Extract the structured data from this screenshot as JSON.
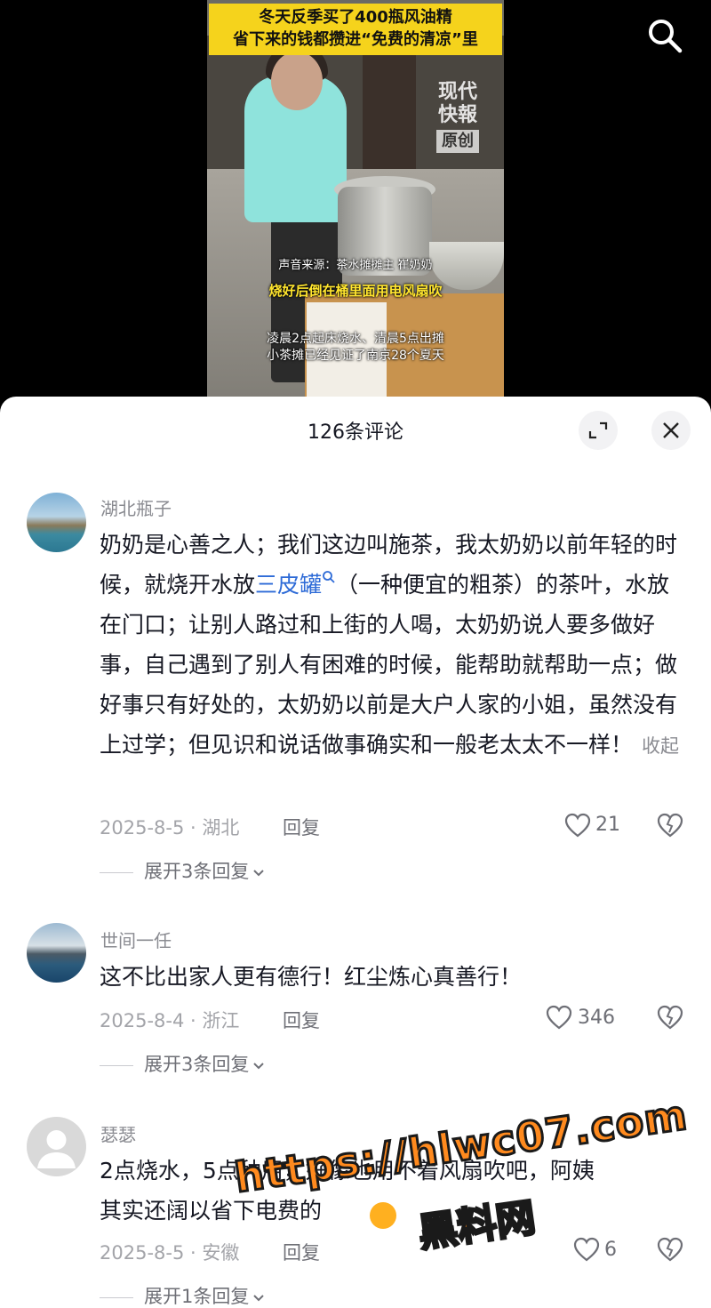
{
  "video": {
    "banner_line1": "冬天反季买了400瓶风油精",
    "banner_line2": "省下来的钱都攒进“免费的清凉”里",
    "logo_text_1": "现代",
    "logo_text_2": "快報",
    "logo_tag": "原创",
    "subtitle_source": "声音来源：茶水摊摊主 崔奶奶",
    "subtitle_main": "烧好后倒在桶里面用电风扇吹",
    "subtitle_line1": "凌晨2点起床烧水、清晨5点出摊",
    "subtitle_line2": "小茶摊已经见证了南京28个夏天",
    "search_icon": "search-icon"
  },
  "sheet": {
    "title": "126条评论",
    "expand_icon": "fullscreen-icon",
    "close_icon": "close-icon"
  },
  "comments": [
    {
      "author": "湖北瓶子",
      "text_before_link": "奶奶是心善之人；我们这边叫施茶，我太奶奶以前年轻的时候，就烧开水放",
      "link": "三皮罐",
      "text_after_link": "（一种便宜的粗茶）的茶叶，水放在门口；让别人路过和上街的人喝，太奶奶说人要多做好事，自己遇到了别人有困难的时候，能帮助就帮助一点；做好事只有好处的，太奶奶以前是大户人家的小姐，虽然没有上过学；但见识和说话做事确实和一般老太太不一样！",
      "collapse": "收起",
      "meta": "2025-8-5 · 湖北",
      "reply": "回复",
      "likes": "21",
      "expand": "展开3条回复"
    },
    {
      "author": "世间一任",
      "text": "这不比出家人更有德行！红尘炼心真善行！",
      "meta": "2025-8-4 · 浙江",
      "reply": "回复",
      "likes": "346",
      "expand": "展开3条回复"
    },
    {
      "author": "瑟瑟",
      "text_line1": "2点烧水，5点种用，好像也用不着风扇吹吧，阿姨",
      "text_line2": "其实还阔以省下电费的",
      "meta": "2025-8-5 · 安徽",
      "reply": "回复",
      "likes": "6",
      "expand": "展开1条回复"
    }
  ],
  "watermark": {
    "url": "https://hlwc07.com",
    "name": "黑料网"
  },
  "colors": {
    "banner": "#f5d31c",
    "link": "#2e6bd7",
    "watermark": "#ff8a1e"
  }
}
